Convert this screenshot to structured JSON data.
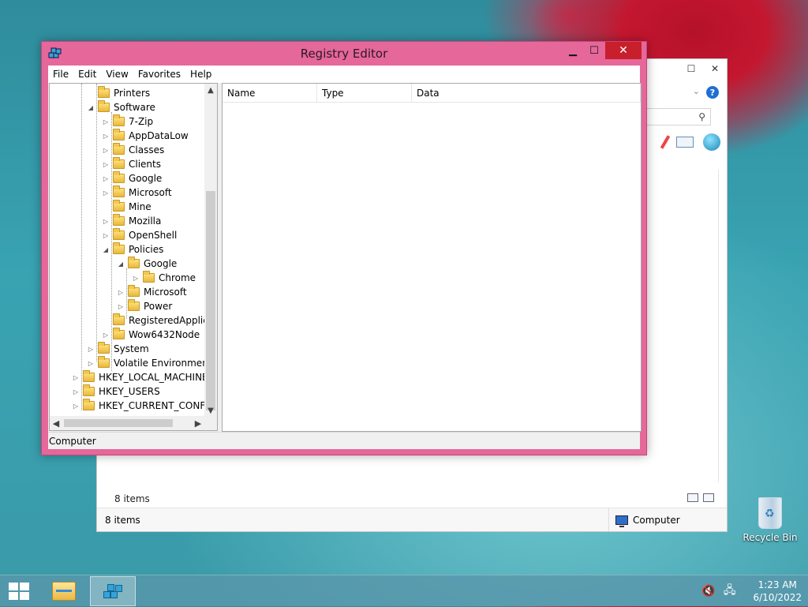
{
  "regedit": {
    "title": "Registry Editor",
    "menu": [
      "File",
      "Edit",
      "View",
      "Favorites",
      "Help"
    ],
    "status": "Computer",
    "list_columns": [
      "Name",
      "Type",
      "Data"
    ],
    "tree": [
      {
        "label": "Printers",
        "expander": "",
        "level": 2
      },
      {
        "label": "Software",
        "expander": "expanded",
        "level": 2
      },
      {
        "label": "7-Zip",
        "expander": "collapsed",
        "level": 3
      },
      {
        "label": "AppDataLow",
        "expander": "collapsed",
        "level": 3
      },
      {
        "label": "Classes",
        "expander": "collapsed",
        "level": 3
      },
      {
        "label": "Clients",
        "expander": "collapsed",
        "level": 3
      },
      {
        "label": "Google",
        "expander": "collapsed",
        "level": 3
      },
      {
        "label": "Microsoft",
        "expander": "collapsed",
        "level": 3
      },
      {
        "label": "Mine",
        "expander": "",
        "level": 3
      },
      {
        "label": "Mozilla",
        "expander": "collapsed",
        "level": 3
      },
      {
        "label": "OpenShell",
        "expander": "collapsed",
        "level": 3
      },
      {
        "label": "Policies",
        "expander": "expanded",
        "level": 3
      },
      {
        "label": "Google",
        "expander": "expanded",
        "level": 4
      },
      {
        "label": "Chrome",
        "expander": "collapsed",
        "level": 5
      },
      {
        "label": "Microsoft",
        "expander": "collapsed",
        "level": 4
      },
      {
        "label": "Power",
        "expander": "collapsed",
        "level": 4
      },
      {
        "label": "RegisteredApplica",
        "expander": "",
        "level": 3
      },
      {
        "label": "Wow6432Node",
        "expander": "collapsed",
        "level": 3
      },
      {
        "label": "System",
        "expander": "collapsed",
        "level": 2
      },
      {
        "label": "Volatile Environment",
        "expander": "collapsed",
        "level": 2
      },
      {
        "label": "HKEY_LOCAL_MACHINE",
        "expander": "collapsed",
        "level": 1
      },
      {
        "label": "HKEY_USERS",
        "expander": "collapsed",
        "level": 1
      },
      {
        "label": "HKEY_CURRENT_CONFIG",
        "expander": "collapsed",
        "level": 1
      }
    ]
  },
  "explorer_bg": {
    "items_inner": "8 items",
    "items_status": "8 items",
    "location": "Computer"
  },
  "desktop": {
    "recycle_bin": "Recycle Bin"
  },
  "taskbar": {
    "time": "1:23 AM",
    "date": "6/10/2022"
  },
  "colors": {
    "regedit_frame": "#e6679a",
    "close_button": "#c7202c"
  }
}
